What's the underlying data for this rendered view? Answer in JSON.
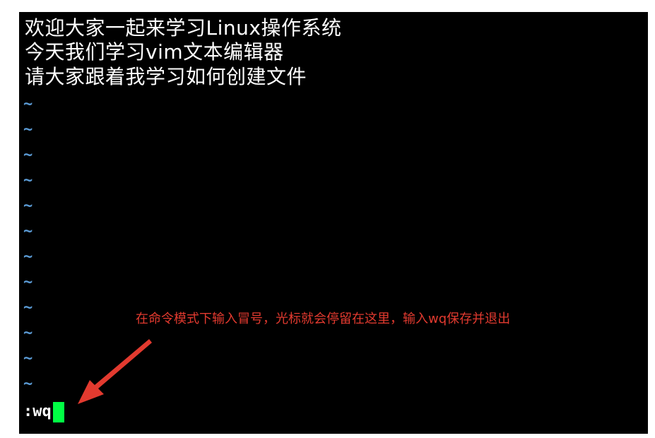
{
  "colors": {
    "background": "#000000",
    "text": "#ffffff",
    "tilde": "#5b9bd5",
    "cursor": "#00ff44",
    "annotation": "#e23a2f"
  },
  "buffer": {
    "lines": [
      "欢迎大家一起来学习Linux操作系统",
      "今天我们学习vim文本编辑器",
      "请大家跟着我学习如何创建文件"
    ],
    "empty_marker": "~"
  },
  "command_line": {
    "text": ":wq"
  },
  "annotation": {
    "text": "在命令模式下输入冒号，光标就会停留在这里，输入wq保存并退出"
  }
}
